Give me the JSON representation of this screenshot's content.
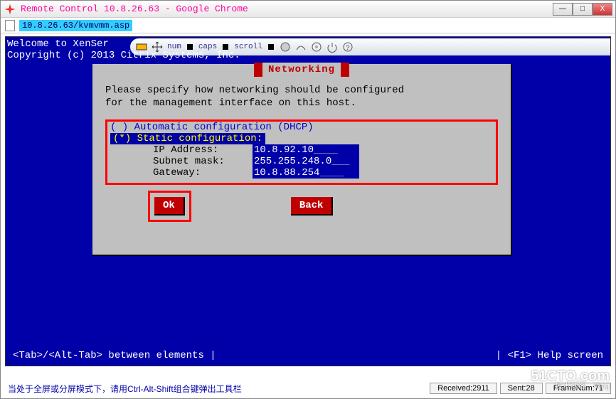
{
  "window": {
    "title": "Remote Control 10.8.26.63 - Google Chrome",
    "url": "10.8.26.63/kvmvmm.asp",
    "min": "—",
    "max": "□",
    "close": "X"
  },
  "toolbar": {
    "num": "num",
    "caps": "caps",
    "scroll": "scroll"
  },
  "welcome": {
    "line1": "Welcome to XenSer",
    "line2": "Copyright (c) 2013 Citrix Systems, Inc."
  },
  "dialog": {
    "title": "Networking",
    "msg1": "Please specify how networking should be configured",
    "msg2": "for the management interface on this host.",
    "opt_auto": "( ) Automatic configuration (DHCP)",
    "opt_static": "(*) Static configuration:",
    "ip_label": "IP Address:",
    "ip_val": "10.8.92.10",
    "mask_label": "Subnet mask:",
    "mask_val": "255.255.248.0",
    "gw_label": "Gateway:",
    "gw_val": "10.8.88.254",
    "ok": "Ok",
    "back": "Back"
  },
  "footer": {
    "left": "<Tab>/<Alt-Tab> between elements   |",
    "right": "|   <F1> Help screen"
  },
  "status": {
    "hint": "当处于全屏或分屏模式下，请用Ctrl-Alt-Shift组合键弹出工具栏",
    "recv": "Received:2911",
    "sent": "Sent:28",
    "frame": "FrameNum:71"
  },
  "watermark": {
    "big": "51CTO.com",
    "small": "技术博客 Blog"
  }
}
